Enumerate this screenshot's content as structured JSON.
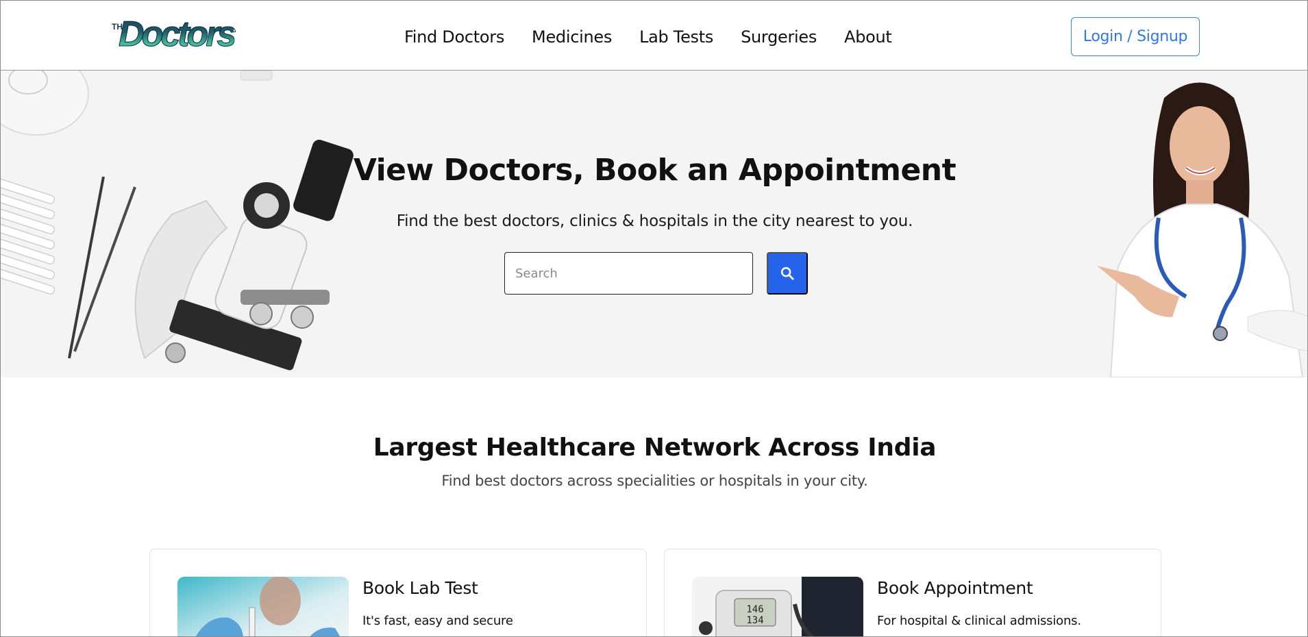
{
  "brand": {
    "logo_small": "THE",
    "logo_word": "Doctors"
  },
  "nav": {
    "items": [
      "Find Doctors",
      "Medicines",
      "Lab Tests",
      "Surgeries",
      "About"
    ],
    "login_label": "Login / Signup"
  },
  "hero": {
    "title": "View Doctors, Book an Appointment",
    "subtitle": "Find the best doctors, clinics & hospitals in the city nearest to you.",
    "search_placeholder": "Search",
    "search_icon": "search-icon"
  },
  "section": {
    "title": "Largest Healthcare Network Across India",
    "subtitle": "Find best doctors across specialities or hospitals in your city."
  },
  "cards": [
    {
      "title": "Book Lab Test",
      "desc": "It's fast, easy and secure"
    },
    {
      "title": "Book Appointment",
      "desc": "For hospital & clinical admissions."
    }
  ],
  "colors": {
    "accent": "#2563eb",
    "login_border": "#3a86e8",
    "hero_bg": "#f4f4f4"
  }
}
